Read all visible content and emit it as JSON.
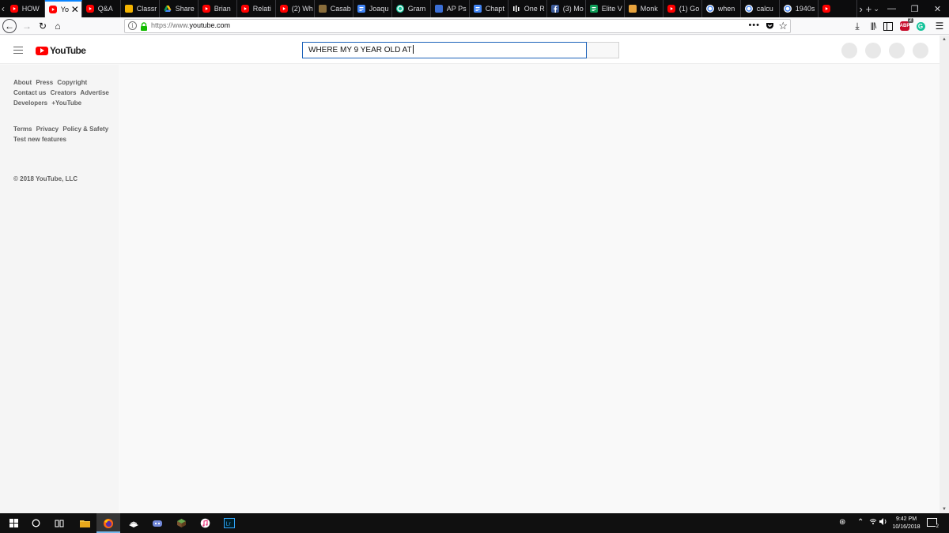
{
  "browser": {
    "tabs": [
      {
        "title": "HOW",
        "icon": "youtube-icon",
        "color": "#ff0000"
      },
      {
        "title": "Yo",
        "icon": "youtube-icon",
        "color": "#ff0000",
        "active": true
      },
      {
        "title": "Q&A",
        "icon": "youtube-icon",
        "color": "#ff0000"
      },
      {
        "title": "Classr",
        "icon": "classroom-icon",
        "color": "#f4b400"
      },
      {
        "title": "Share",
        "icon": "drive-icon",
        "color": "#1fa463"
      },
      {
        "title": "Brian",
        "icon": "youtube-icon",
        "color": "#ff0000"
      },
      {
        "title": "Relati",
        "icon": "youtube-icon",
        "color": "#ff0000"
      },
      {
        "title": "(2) Wh",
        "icon": "youtube-icon",
        "color": "#ff0000"
      },
      {
        "title": "Casab",
        "icon": "casablanca-icon",
        "color": "#8a6d3b"
      },
      {
        "title": "Joaqu",
        "icon": "docs-icon",
        "color": "#4285f4"
      },
      {
        "title": "Gram",
        "icon": "grammarly-icon",
        "color": "#15c39a"
      },
      {
        "title": "AP Ps",
        "icon": "person-icon",
        "color": "#3b6fd6"
      },
      {
        "title": "Chapt",
        "icon": "docs-icon",
        "color": "#4285f4"
      },
      {
        "title": "One R",
        "icon": "onerun-icon",
        "color": "#ffffff"
      },
      {
        "title": "(3) Mo",
        "icon": "facebook-icon",
        "color": "#3b5998"
      },
      {
        "title": "Elite V",
        "icon": "sheets-icon",
        "color": "#0f9d58"
      },
      {
        "title": "Monk",
        "icon": "monkey-icon",
        "color": "#e8a33d"
      },
      {
        "title": "(1) Go",
        "icon": "youtube-icon",
        "color": "#ff0000"
      },
      {
        "title": "when",
        "icon": "google-icon",
        "color": "#ffffff"
      },
      {
        "title": "calcu",
        "icon": "google-icon",
        "color": "#ffffff"
      },
      {
        "title": "1940s",
        "icon": "google-icon",
        "color": "#ffffff"
      },
      {
        "title": "",
        "icon": "youtube-icon",
        "color": "#ff0000"
      }
    ],
    "url_prefix": "https://www.",
    "url_host": "youtube.com",
    "ext_badge_label": "ABP",
    "ext_badge_count": "2",
    "grammarly_label": "G"
  },
  "youtube": {
    "logo_text": "YouTube",
    "search_value": "WHERE MY 9 YEAR OLD AT"
  },
  "guide": {
    "links_primary": [
      "About",
      "Press",
      "Copyright",
      "Contact us",
      "Creators",
      "Advertise",
      "Developers",
      "+YouTube"
    ],
    "links_secondary": [
      "Terms",
      "Privacy",
      "Policy & Safety",
      "Test new features"
    ],
    "copyright": "© 2018 YouTube, LLC"
  },
  "taskbar": {
    "apps": [
      "file-explorer-icon",
      "firefox-icon",
      "steam-icon",
      "discord-icon",
      "minecraft-icon",
      "itunes-icon",
      "lightroom-icon"
    ],
    "time": "9:42 PM",
    "date": "10/16/2018",
    "notification_count": "2"
  },
  "colors": {
    "youtube_red": "#ff0000",
    "search_focus": "#1c62b9",
    "firefox_blue": "#0a84ff"
  }
}
